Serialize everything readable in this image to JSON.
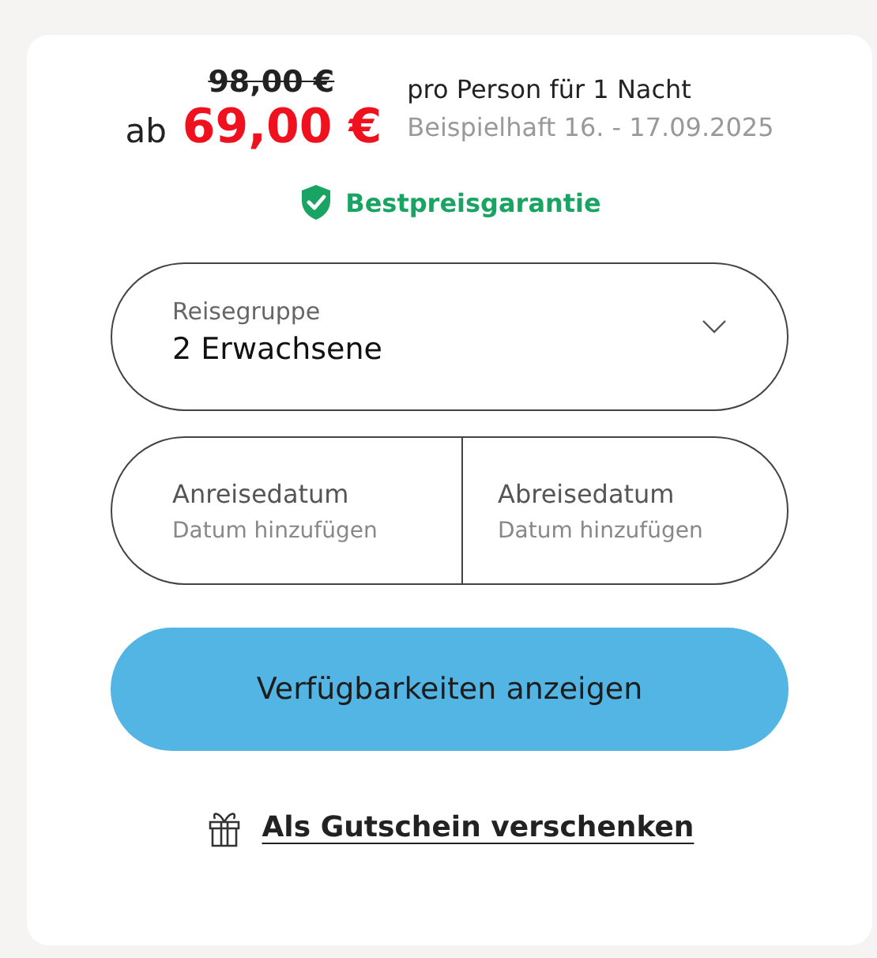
{
  "price": {
    "old": "98,00 €",
    "prefix": "ab",
    "current": "69,00 €",
    "per": "pro Person für 1 Nacht",
    "example": "Beispielhaft 16. - 17.09.2025"
  },
  "guarantee": {
    "label": "Bestpreisgarantie"
  },
  "travel_group": {
    "label": "Reisegruppe",
    "value": "2 Erwachsene"
  },
  "dates": [
    {
      "label": "Anreisedatum",
      "placeholder": "Datum hinzufügen"
    },
    {
      "label": "Abreisedatum",
      "placeholder": "Datum hinzufügen"
    }
  ],
  "button": "Verfügbarkeiten anzeigen",
  "gift_link": "Als Gutschein verschenken"
}
